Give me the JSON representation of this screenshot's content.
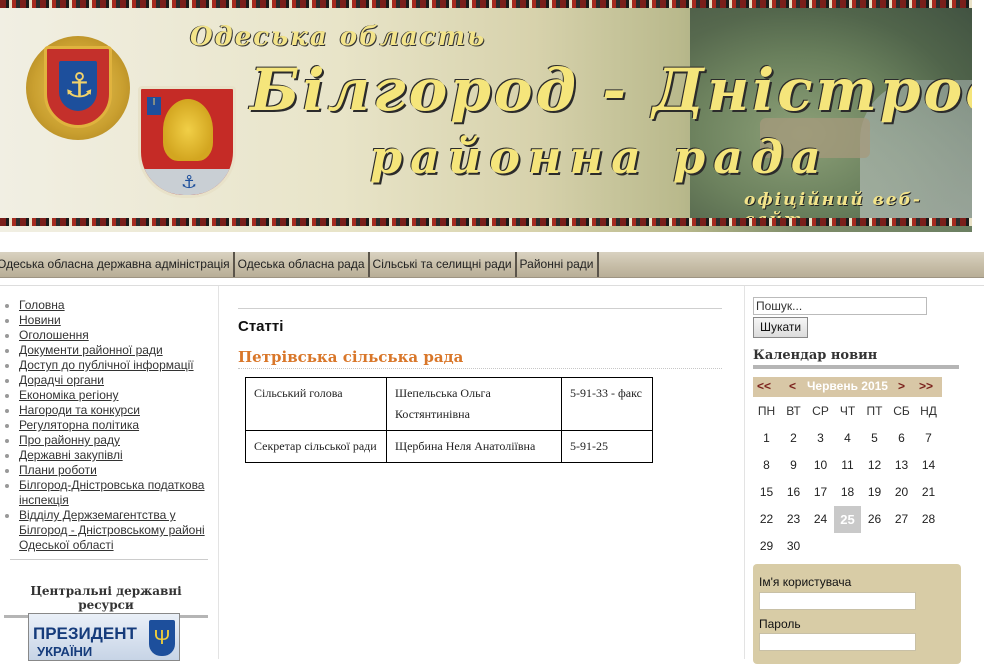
{
  "header": {
    "region": "Одеська область",
    "title_line1": "Білгород - Дністровська",
    "title_line2": "районна рада",
    "site_label": "офіційний веб-сайт"
  },
  "navbar": {
    "items": [
      "Одеська обласна державна адміністрація",
      "Одеська обласна рада",
      "Сільські та селищні ради",
      "Районні ради"
    ]
  },
  "left_menu": {
    "items": [
      "Головна",
      "Новини",
      "Оголошення",
      "Документи районної ради",
      "Доступ до публічної інформації",
      "Дорадчі органи",
      "Економіка регіону",
      "Нагороди та конкурси",
      "Регуляторна політика",
      "Про районну раду",
      "Державні закупівлі",
      "Плани роботи",
      "Білгород-Дністровська податкова інспекція",
      "Відділу Держземагентства у Білгород - Дністровському районі Одеської області"
    ],
    "resources_title": "Центральні державні ресурси",
    "president_banner": {
      "line1": "ПРЕЗИДЕНТ",
      "line2": "УКРАЇНИ"
    }
  },
  "content": {
    "section_title": "Статті",
    "article_title": "Петрівська сільська рада",
    "table": [
      [
        "Сільський голова",
        "Шепельська Ольга Костянтинівна",
        "5-91-33 - факс"
      ],
      [
        "Секретар сільської ради",
        "Щербина Неля Анатоліївна",
        "5-91-25"
      ]
    ]
  },
  "sidebar": {
    "search_placeholder": "Пошук...",
    "search_button": "Шукати",
    "calendar_title": "Календар новин",
    "calendar": {
      "nav_prev_year": "<<",
      "nav_prev": "<",
      "month": "Червень 2015",
      "nav_next": ">",
      "nav_next_year": ">>",
      "weekdays": [
        "ПН",
        "ВТ",
        "СР",
        "ЧТ",
        "ПТ",
        "СБ",
        "НД"
      ],
      "weeks": [
        [
          "1",
          "2",
          "3",
          "4",
          "5",
          "6",
          "7"
        ],
        [
          "8",
          "9",
          "10",
          "11",
          "12",
          "13",
          "14"
        ],
        [
          "15",
          "16",
          "17",
          "18",
          "19",
          "20",
          "21"
        ],
        [
          "22",
          "23",
          "24",
          "25",
          "26",
          "27",
          "28"
        ],
        [
          "29",
          "30",
          "",
          "",
          "",
          "",
          ""
        ]
      ],
      "today": "25"
    },
    "login": {
      "username_label": "Ім'я користувача",
      "password_label": "Пароль"
    }
  }
}
